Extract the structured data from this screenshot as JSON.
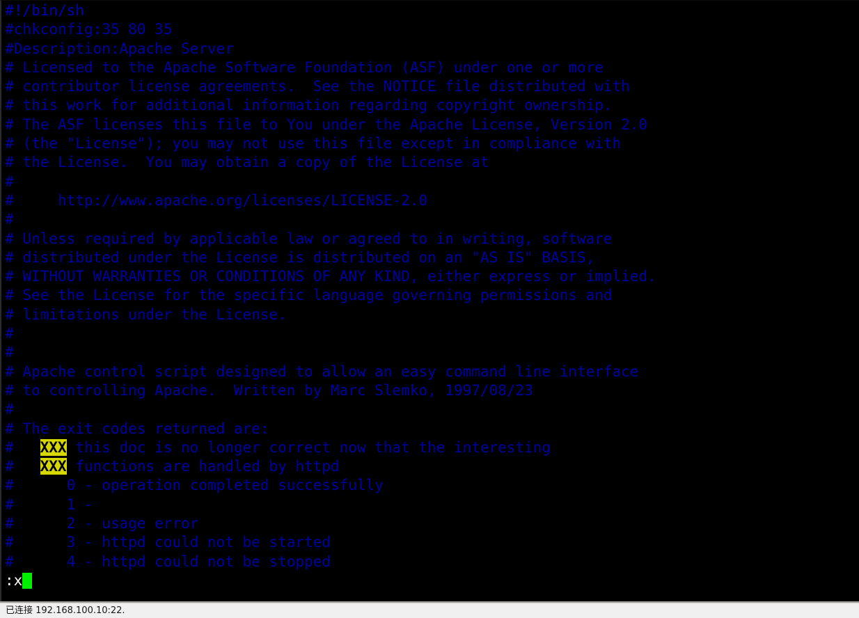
{
  "window": {
    "type": "ssh-terminal-vim",
    "colors": {
      "background": "#000000",
      "comment_text": "#00009f",
      "command_text": "#ffffff",
      "search_highlight_bg": "#d7d700",
      "search_highlight_fg": "#000000",
      "cursor": "#00ee00",
      "statusbar_bg": "#f0f0f0",
      "statusbar_fg": "#1a1a1a"
    }
  },
  "terminal": {
    "lines": [
      {
        "text": "#!/bin/sh",
        "class": "shebang"
      },
      {
        "text": "#chkconfig:35 80 35",
        "class": "comment"
      },
      {
        "text": "#Description:Apache Server",
        "class": "comment"
      },
      {
        "text": "# Licensed to the Apache Software Foundation (ASF) under one or more",
        "class": "comment"
      },
      {
        "text": "# contributor license agreements.  See the NOTICE file distributed with",
        "class": "comment"
      },
      {
        "text": "# this work for additional information regarding copyright ownership.",
        "class": "comment"
      },
      {
        "text": "# The ASF licenses this file to You under the Apache License, Version 2.0",
        "class": "comment"
      },
      {
        "text": "# (the \"License\"); you may not use this file except in compliance with",
        "class": "comment"
      },
      {
        "text": "# the License.  You may obtain a copy of the License at",
        "class": "comment"
      },
      {
        "text": "#",
        "class": "comment"
      },
      {
        "text": "#     http://www.apache.org/licenses/LICENSE-2.0",
        "class": "comment"
      },
      {
        "text": "#",
        "class": "comment"
      },
      {
        "text": "# Unless required by applicable law or agreed to in writing, software",
        "class": "comment"
      },
      {
        "text": "# distributed under the License is distributed on an \"AS IS\" BASIS,",
        "class": "comment"
      },
      {
        "text": "# WITHOUT WARRANTIES OR CONDITIONS OF ANY KIND, either express or implied.",
        "class": "comment"
      },
      {
        "text": "# See the License for the specific language governing permissions and",
        "class": "comment"
      },
      {
        "text": "# limitations under the License.",
        "class": "comment"
      },
      {
        "text": "#",
        "class": "comment"
      },
      {
        "text": "#",
        "class": "comment"
      },
      {
        "text": "# Apache control script designed to allow an easy command line interface",
        "class": "comment"
      },
      {
        "text": "# to controlling Apache.  Written by Marc Slemko, 1997/08/23",
        "class": "comment"
      },
      {
        "text": "#",
        "class": "comment"
      },
      {
        "text": "# The exit codes returned are:",
        "class": "comment"
      },
      {
        "prefix": "#   ",
        "highlight": "XXX",
        "suffix": " this doc is no longer correct now that the interesting",
        "class": "comment"
      },
      {
        "prefix": "#   ",
        "highlight": "XXX",
        "suffix": " functions are handled by httpd",
        "class": "comment"
      },
      {
        "text": "#      0 - operation completed successfully",
        "class": "comment"
      },
      {
        "text": "#      1 -",
        "class": "comment"
      },
      {
        "text": "#      2 - usage error",
        "class": "comment"
      },
      {
        "text": "#      3 - httpd could not be started",
        "class": "comment"
      },
      {
        "text": "#      4 - httpd could not be stopped",
        "class": "comment"
      }
    ],
    "command_line": {
      "text": ":x",
      "cursor_visible": true
    }
  },
  "statusbar": {
    "connection_text": "已连接 192.168.100.10:22."
  }
}
